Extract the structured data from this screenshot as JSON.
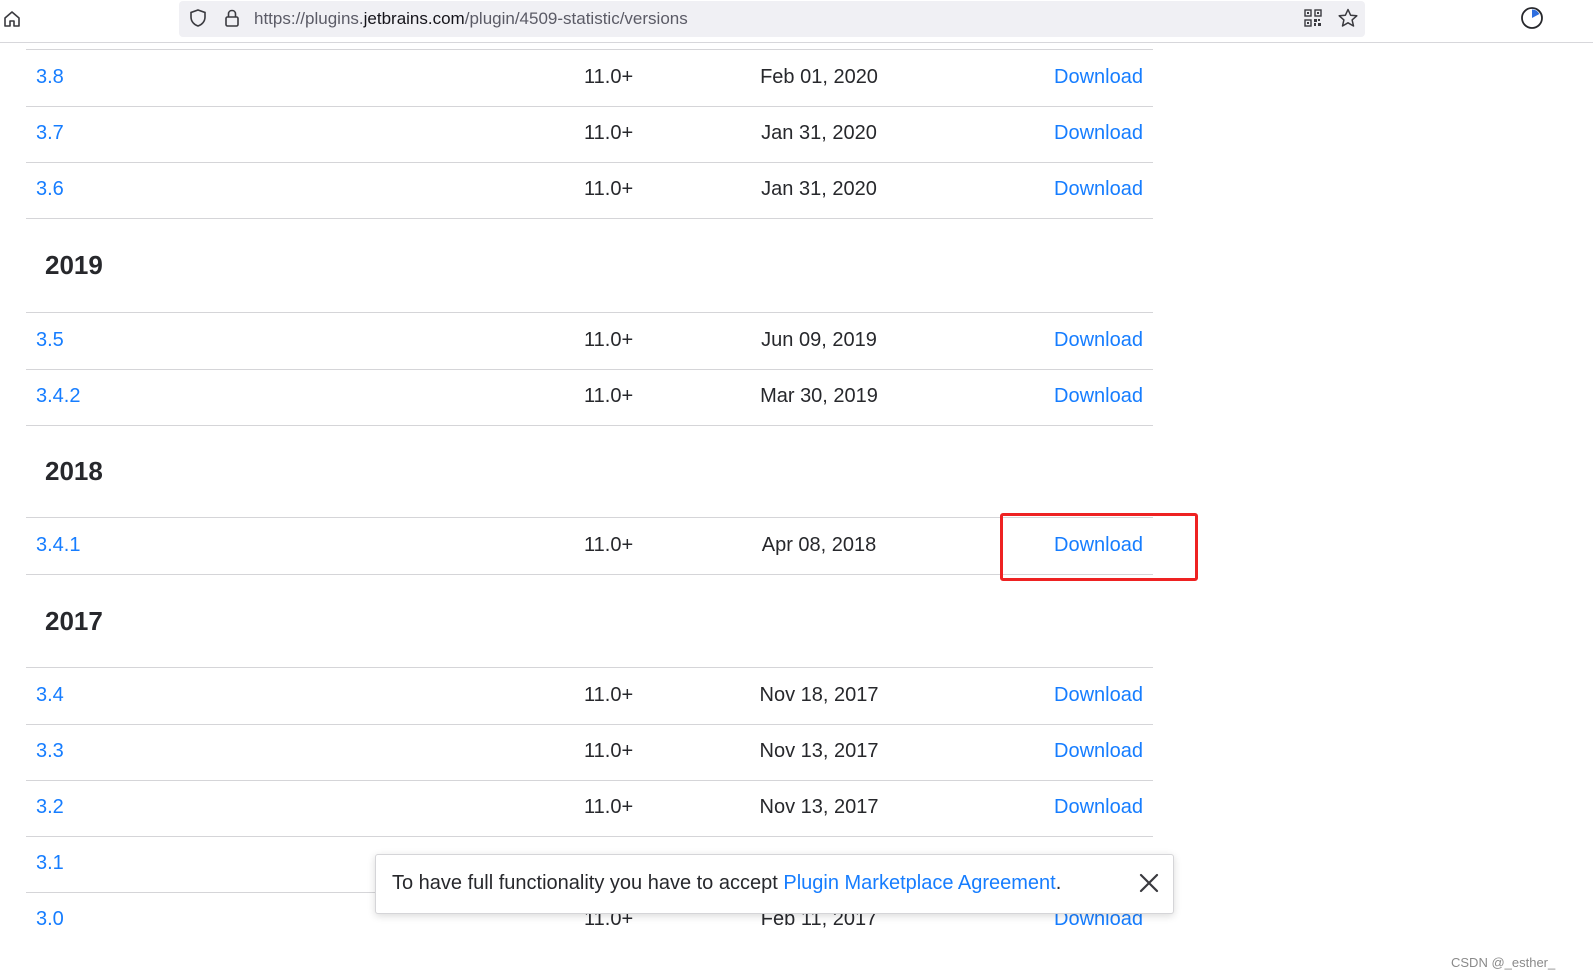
{
  "browser": {
    "url_prefix": "https://plugins.",
    "url_domain": "jetbrains.com",
    "url_path": "/plugin/4509-statistic/versions",
    "icons": [
      "home-icon",
      "shield-icon",
      "lock-icon",
      "qr-code-icon",
      "star-icon",
      "extension-icon"
    ]
  },
  "years": {
    "y2019": "2019",
    "y2018": "2018",
    "y2017": "2017"
  },
  "rows": [
    {
      "version": "3.8",
      "compat": "11.0+",
      "date": "Feb 01, 2020",
      "action": "Download"
    },
    {
      "version": "3.7",
      "compat": "11.0+",
      "date": "Jan 31, 2020",
      "action": "Download"
    },
    {
      "version": "3.6",
      "compat": "11.0+",
      "date": "Jan 31, 2020",
      "action": "Download"
    },
    {
      "version": "3.5",
      "compat": "11.0+",
      "date": "Jun 09, 2019",
      "action": "Download"
    },
    {
      "version": "3.4.2",
      "compat": "11.0+",
      "date": "Mar 30, 2019",
      "action": "Download"
    },
    {
      "version": "3.4.1",
      "compat": "11.0+",
      "date": "Apr 08, 2018",
      "action": "Download"
    },
    {
      "version": "3.4",
      "compat": "11.0+",
      "date": "Nov 18, 2017",
      "action": "Download"
    },
    {
      "version": "3.3",
      "compat": "11.0+",
      "date": "Nov 13, 2017",
      "action": "Download"
    },
    {
      "version": "3.2",
      "compat": "11.0+",
      "date": "Nov 13, 2017",
      "action": "Download"
    },
    {
      "version": "3.1",
      "compat": "",
      "date": "",
      "action": ""
    },
    {
      "version": "3.0",
      "compat": "11.0+",
      "date": "Feb 11, 2017",
      "action": "Download"
    }
  ],
  "toast": {
    "text": "To have full functionality you have to accept ",
    "link": "Plugin Marketplace Agreement",
    "suffix": "."
  },
  "colors": {
    "link": "#167dff",
    "highlight": "#ee2222"
  },
  "watermark": "CSDN @_esther_"
}
